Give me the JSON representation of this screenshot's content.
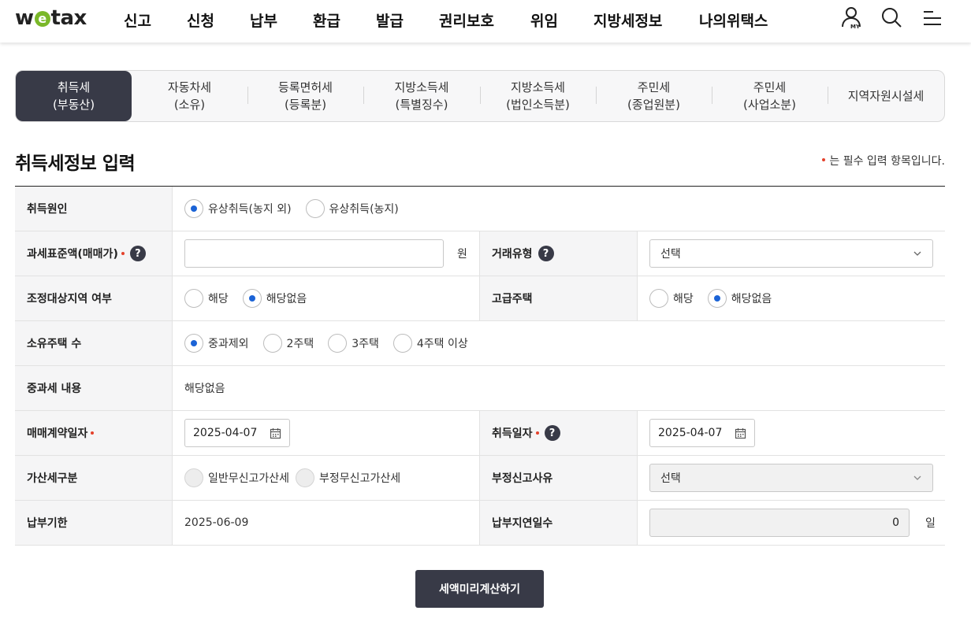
{
  "header": {
    "logo": "wetax",
    "logo_prefix": "w",
    "logo_e": "e",
    "logo_suffix": "tax",
    "nav": [
      "신고",
      "신청",
      "납부",
      "환급",
      "발급",
      "권리보호",
      "위임",
      "지방세정보",
      "나의위택스"
    ],
    "my_label": "MY"
  },
  "tabs": [
    {
      "label": "취득세\n(부동산)",
      "active": true
    },
    {
      "label": "자동차세\n(소유)",
      "active": false
    },
    {
      "label": "등록면허세\n(등록분)",
      "active": false
    },
    {
      "label": "지방소득세\n(특별징수)",
      "active": false
    },
    {
      "label": "지방소득세\n(법인소득분)",
      "active": false
    },
    {
      "label": "주민세\n(종업원분)",
      "active": false
    },
    {
      "label": "주민세\n(사업소분)",
      "active": false
    },
    {
      "label": "지역자원시설세",
      "active": false
    }
  ],
  "section": {
    "title": "취득세정보 입력",
    "required_note": "는 필수 입력 항목입니다."
  },
  "form": {
    "acq_cause": {
      "label": "취득원인",
      "options": [
        "유상취득(농지 외)",
        "유상취득(농지)"
      ],
      "selected": 0
    },
    "tax_base": {
      "label": "과세표준액(매매가)",
      "value": "",
      "unit": "원"
    },
    "trade_type": {
      "label": "거래유형",
      "value": "선택"
    },
    "adjust_area": {
      "label": "조정대상지역 여부",
      "options": [
        "해당",
        "해당없음"
      ],
      "selected": 1
    },
    "luxury_house": {
      "label": "고급주택",
      "options": [
        "해당",
        "해당없음"
      ],
      "selected": 1
    },
    "house_count": {
      "label": "소유주택 수",
      "options": [
        "중과제외",
        "2주택",
        "3주택",
        "4주택 이상"
      ],
      "selected": 0
    },
    "surcharge": {
      "label": "중과세 내용",
      "value": "해당없음"
    },
    "contract_date": {
      "label": "매매계약일자",
      "value": "2025-04-07"
    },
    "acq_date": {
      "label": "취득일자",
      "value": "2025-04-07"
    },
    "penalty_type": {
      "label": "가산세구분",
      "options": [
        "일반무신고가산세",
        "부정무신고가산세"
      ]
    },
    "fraud_reason": {
      "label": "부정신고사유",
      "value": "선택"
    },
    "due_date": {
      "label": "납부기한",
      "value": "2025-06-09"
    },
    "delay_days": {
      "label": "납부지연일수",
      "value": "0",
      "unit": "일"
    }
  },
  "actions": {
    "calc_button": "세액미리계산하기"
  },
  "colors": {
    "primary_dark": "#383a47",
    "radio_on": "#1b63d6",
    "required": "#e4412b",
    "logo_green": "#7ab829"
  }
}
